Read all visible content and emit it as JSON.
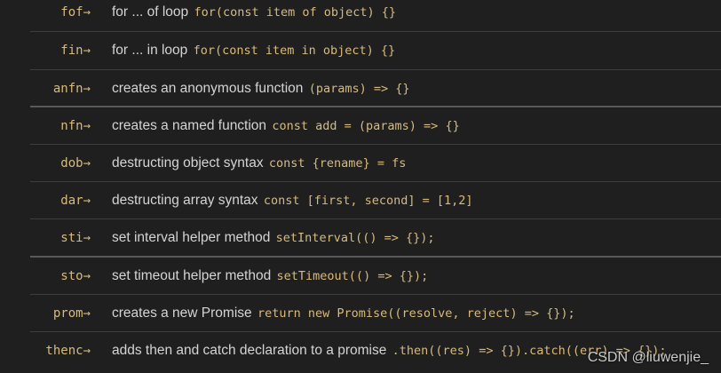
{
  "snippets": [
    {
      "prefix": "fof→",
      "description": "for ... of loop",
      "code": "for(const item of object) {}"
    },
    {
      "prefix": "fin→",
      "description": "for ... in loop",
      "code": "for(const item in object) {}"
    },
    {
      "prefix": "anfn→",
      "description": "creates an anonymous function",
      "code": "(params) => {}"
    },
    {
      "prefix": "nfn→",
      "description": "creates a named function",
      "code": "const add = (params) => {}"
    },
    {
      "prefix": "dob→",
      "description": "destructing object syntax",
      "code": "const {rename} = fs"
    },
    {
      "prefix": "dar→",
      "description": "destructing array syntax",
      "code": "const [first, second] = [1,2]"
    },
    {
      "prefix": "sti→",
      "description": "set interval helper method",
      "code": "setInterval(() => {});"
    },
    {
      "prefix": "sto→",
      "description": "set timeout helper method",
      "code": "setTimeout(() => {});"
    },
    {
      "prefix": "prom→",
      "description": "creates a new Promise",
      "code": "return new Promise((resolve, reject) => {});"
    },
    {
      "prefix": "thenc→",
      "description": "adds then and catch declaration to a promise",
      "code": ".then((res) => {}).catch((err) => {});"
    }
  ],
  "watermark": "CSDN @liuwenjie_",
  "colors": {
    "background": "#1f1f1f",
    "prefix": "#d7ba7d",
    "code": "#d7ba7d",
    "text": "#d4d4d4",
    "divider": "#3e3e3e"
  }
}
